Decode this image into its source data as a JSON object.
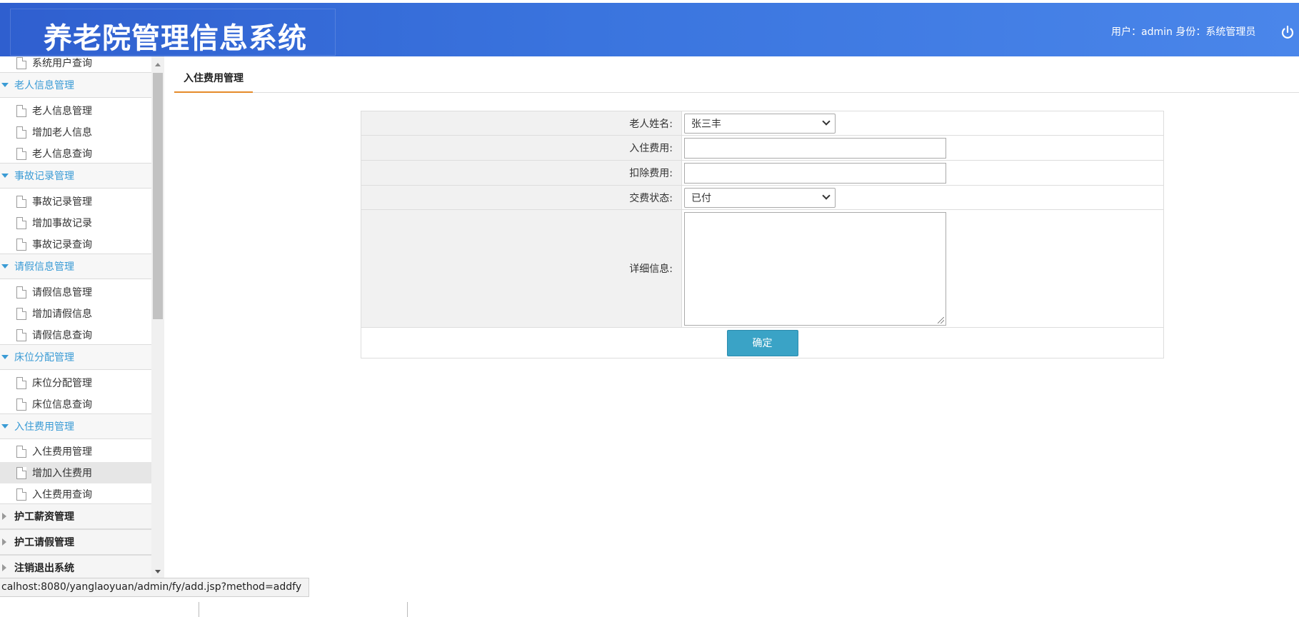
{
  "header": {
    "title": "养老院管理信息系统",
    "userinfo": "用户：admin 身份：系统管理员"
  },
  "sidebar": {
    "top_partial_item": "系统用户查询",
    "groups": [
      {
        "label": "老人信息管理",
        "items": [
          "老人信息管理",
          "增加老人信息",
          "老人信息查询"
        ]
      },
      {
        "label": "事故记录管理",
        "items": [
          "事故记录管理",
          "增加事故记录",
          "事故记录查询"
        ]
      },
      {
        "label": "请假信息管理",
        "items": [
          "请假信息管理",
          "增加请假信息",
          "请假信息查询"
        ]
      },
      {
        "label": "床位分配管理",
        "items": [
          "床位分配管理",
          "床位信息查询"
        ]
      },
      {
        "label": "入住费用管理",
        "items": [
          "入住费用管理",
          "增加入住费用",
          "入住费用查询"
        ]
      }
    ],
    "active_item": "增加入住费用",
    "collapsed_groups": [
      "护工薪资管理",
      "护工请假管理",
      "注销退出系统"
    ]
  },
  "main": {
    "tab": "入住费用管理",
    "form": {
      "elder_name_label": "老人姓名:",
      "elder_name_value": "张三丰",
      "checkin_fee_label": "入住费用:",
      "checkin_fee_value": "",
      "deduct_fee_label": "扣除费用:",
      "deduct_fee_value": "",
      "pay_status_label": "交费状态:",
      "pay_status_value": "已付",
      "detail_label": "详细信息:",
      "detail_value": "",
      "submit_label": "确定"
    }
  },
  "status_bar": {
    "url": "calhost:8080/yanglaoyuan/admin/fy/add.jsp?method=addfy"
  },
  "colors": {
    "header_blue": "#3a74de",
    "group_open_text": "#3a9bd5",
    "tab_underline": "#e58b2a",
    "submit_button": "#3aa3c6"
  }
}
